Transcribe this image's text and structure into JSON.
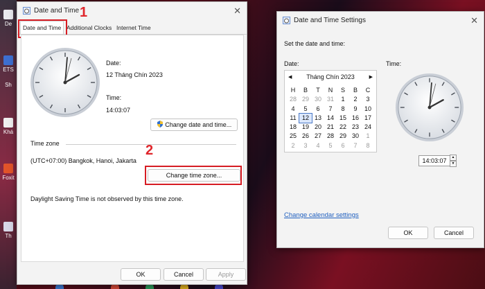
{
  "colors": {
    "accent_red": "#d61c23",
    "link": "#1f5fbf"
  },
  "desktop": {
    "icons": [
      {
        "label": "De",
        "icon": "app-icon"
      },
      {
        "label": "ETS",
        "icon": "app-icon"
      },
      {
        "label": "Sh",
        "icon": "shortcut-icon"
      },
      {
        "label": "Khá",
        "icon": "shortcut-icon"
      },
      {
        "label": "Foxit",
        "icon": "foxit-icon"
      },
      {
        "label": "Th",
        "icon": "app-icon"
      }
    ]
  },
  "main_dialog": {
    "title": "Date and Time",
    "tabs": [
      "Date and Time",
      "Additional Clocks",
      "Internet Time"
    ],
    "date_label": "Date:",
    "date_value": "12 Tháng Chín 2023",
    "time_label": "Time:",
    "time_value": "14:03:07",
    "change_datetime_button": "Change date and time...",
    "timezone_section": "Time zone",
    "timezone_value": "(UTC+07:00) Bangkok, Hanoi, Jakarta",
    "change_timezone_button": "Change time zone...",
    "dst_note": "Daylight Saving Time is not observed by this time zone.",
    "ok": "OK",
    "cancel": "Cancel",
    "apply": "Apply",
    "step1": "1",
    "step2": "2"
  },
  "settings_dialog": {
    "title": "Date and Time Settings",
    "heading": "Set the date and time:",
    "date_label": "Date:",
    "time_label": "Time:",
    "calendar": {
      "month_label": "Tháng Chín 2023",
      "prev": "◀",
      "next": "▶",
      "weekdays": [
        "H",
        "B",
        "T",
        "N",
        "S",
        "B",
        "C"
      ],
      "weeks": [
        [
          "28",
          "29",
          "30",
          "31",
          "1",
          "2",
          "3"
        ],
        [
          "4",
          "5",
          "6",
          "7",
          "8",
          "9",
          "10"
        ],
        [
          "11",
          "12",
          "13",
          "14",
          "15",
          "16",
          "17"
        ],
        [
          "18",
          "19",
          "20",
          "21",
          "22",
          "23",
          "24"
        ],
        [
          "25",
          "26",
          "27",
          "28",
          "29",
          "30",
          "1"
        ],
        [
          "2",
          "3",
          "4",
          "5",
          "6",
          "7",
          "8"
        ]
      ],
      "selected": "12"
    },
    "time_value": "14:03:07",
    "calendar_link": "Change calendar settings",
    "ok": "OK",
    "cancel": "Cancel"
  }
}
